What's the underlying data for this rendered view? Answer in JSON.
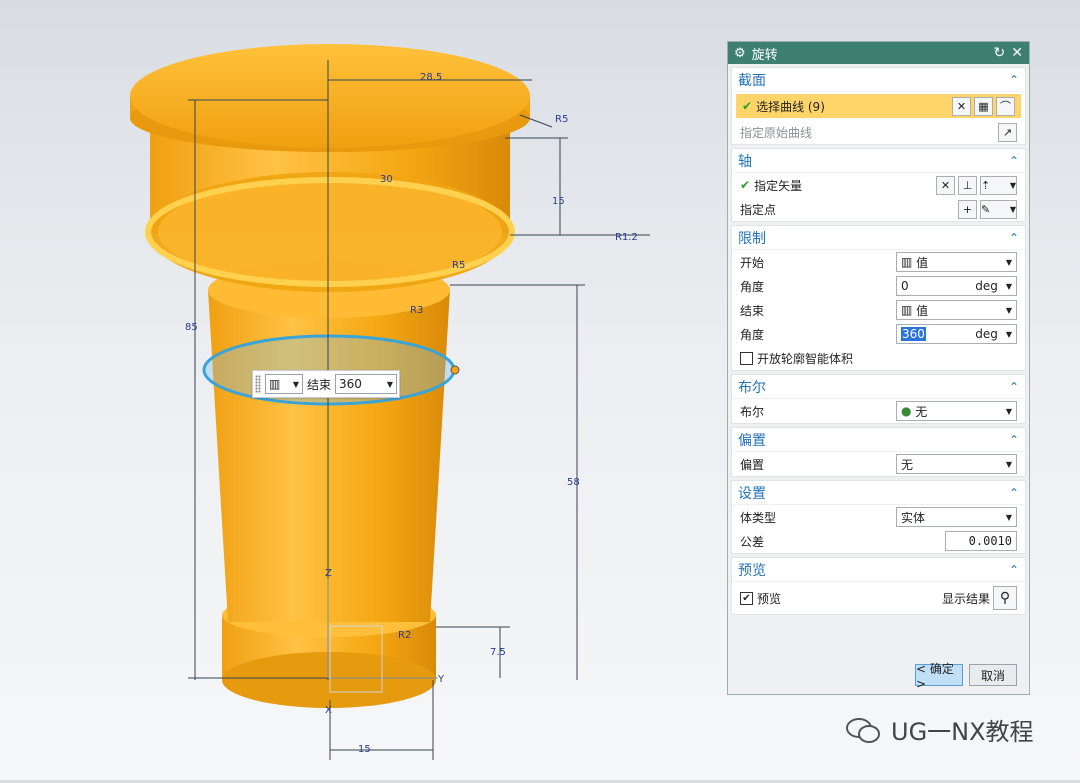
{
  "dialog": {
    "title": "旋转",
    "sections": {
      "section_curve": {
        "header": "截面",
        "select_curve_label": "选择曲线 (9)",
        "original_curve_label": "指定原始曲线"
      },
      "axis": {
        "header": "轴",
        "vector_label": "指定矢量",
        "point_label": "指定点"
      },
      "limits": {
        "header": "限制",
        "start_label": "开始",
        "start_value": "值",
        "start_angle_label": "角度",
        "start_angle": "0",
        "end_label": "结束",
        "end_value": "值",
        "end_angle_label": "角度",
        "end_angle": "360",
        "unit": "deg",
        "open_profile_label": "开放轮廓智能体积"
      },
      "boolean": {
        "header": "布尔",
        "label": "布尔",
        "value": "无"
      },
      "offset": {
        "header": "偏置",
        "label": "偏置",
        "value": "无"
      },
      "settings": {
        "header": "设置",
        "body_type_label": "体类型",
        "body_type_value": "实体",
        "tolerance_label": "公差",
        "tolerance_value": "0.0010"
      },
      "preview": {
        "header": "预览",
        "preview_label": "预览",
        "show_result_label": "显示结果"
      }
    },
    "ok_label": "< 确定 >",
    "cancel_label": "取消"
  },
  "floating_widget": {
    "label": "结束",
    "value": "360"
  },
  "dimensions": {
    "top_radius": "28.5",
    "angle_top": "R5",
    "height_15": "15",
    "radius_r12": "R1.2",
    "mid_dim": "30",
    "total_height": "85",
    "lower_height": "58",
    "base_height": "7.5",
    "base_width": "15",
    "r_small": "R2",
    "angle_mid": "R5",
    "angle_lower": "R3"
  },
  "axes": {
    "z": "Z",
    "y": "Y",
    "x": "X"
  },
  "watermark": "UG一NX教程",
  "colors": {
    "model": "#f5a814",
    "dialog_title": "#3d8072",
    "section_header": "#2573b8"
  }
}
